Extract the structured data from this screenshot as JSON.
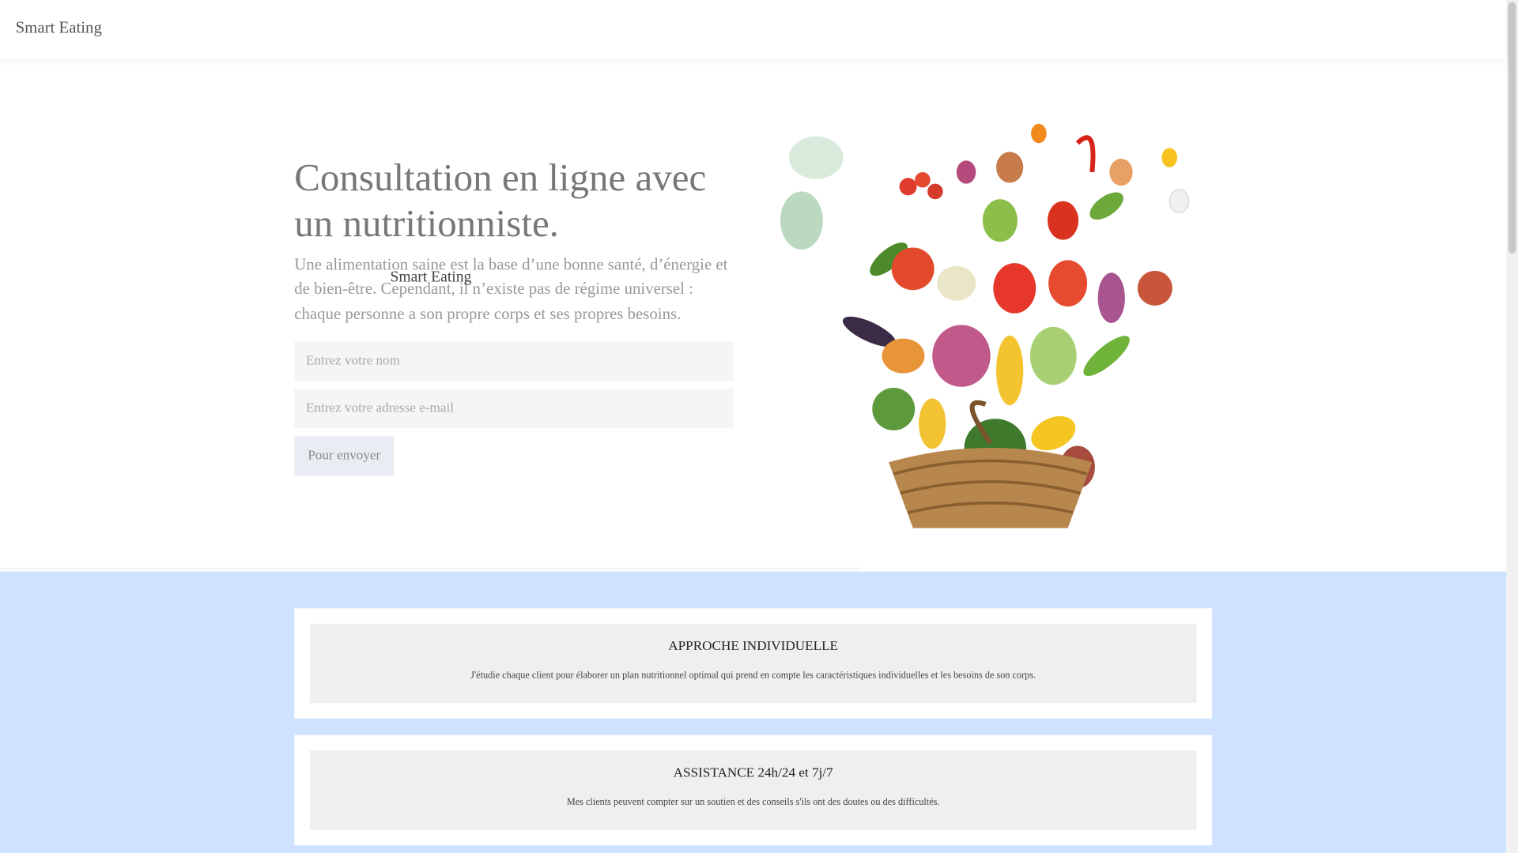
{
  "navbar": {
    "brand": "Smart Eating"
  },
  "hero": {
    "headline": "Consultation en ligne avec un nutritionniste.",
    "lead": "Une alimentation saine est la base d’une bonne santé, d’énergie et de bien-être. Cependant, il n’existe pas de régime universel : chaque personne a son propre corps et ses propres besoins.",
    "overlay_brand": "Smart Eating",
    "form": {
      "name_placeholder": "Entrez votre nom",
      "name_value": "",
      "email_placeholder": "Entrez votre adresse e-mail",
      "email_value": "",
      "submit_label": "Pour envoyer"
    },
    "image_icon": "vegetable-basket-illustration"
  },
  "features": [
    {
      "title": "APPROCHE INDIVIDUELLE",
      "text": "J'étudie chaque client pour élaborer un plan nutritionnel optimal qui prend en compte les caractéristiques individuelles et les besoins de son corps."
    },
    {
      "title": "ASSISTANCE 24h/24 et 7j/7",
      "text": "Mes clients peuvent compter sur un soutien et des conseils s'ils ont des doutes ou des difficultés."
    }
  ],
  "colors": {
    "features_background": "#cfe2ff",
    "card_inner": "#efefef",
    "headline": "#777777"
  }
}
